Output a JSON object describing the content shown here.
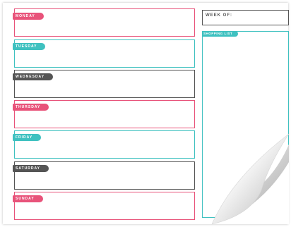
{
  "days": [
    {
      "label": "MONDAY",
      "color": "#e8537a"
    },
    {
      "label": "TUESDAY",
      "color": "#3fc1c0"
    },
    {
      "label": "WEDNESDAY",
      "color": "#555555"
    },
    {
      "label": "THURSDAY",
      "color": "#e8537a"
    },
    {
      "label": "FRIDAY",
      "color": "#3fc1c0"
    },
    {
      "label": "SATURDAY",
      "color": "#555555"
    },
    {
      "label": "SUNDAY",
      "color": "#e8537a"
    }
  ],
  "week_of": {
    "label": "WEEK OF:",
    "color": "#555555"
  },
  "shopping_list": {
    "label": "SHOPPING LIST",
    "color": "#3fc1c0"
  },
  "page_curl_icon": "page-curl"
}
